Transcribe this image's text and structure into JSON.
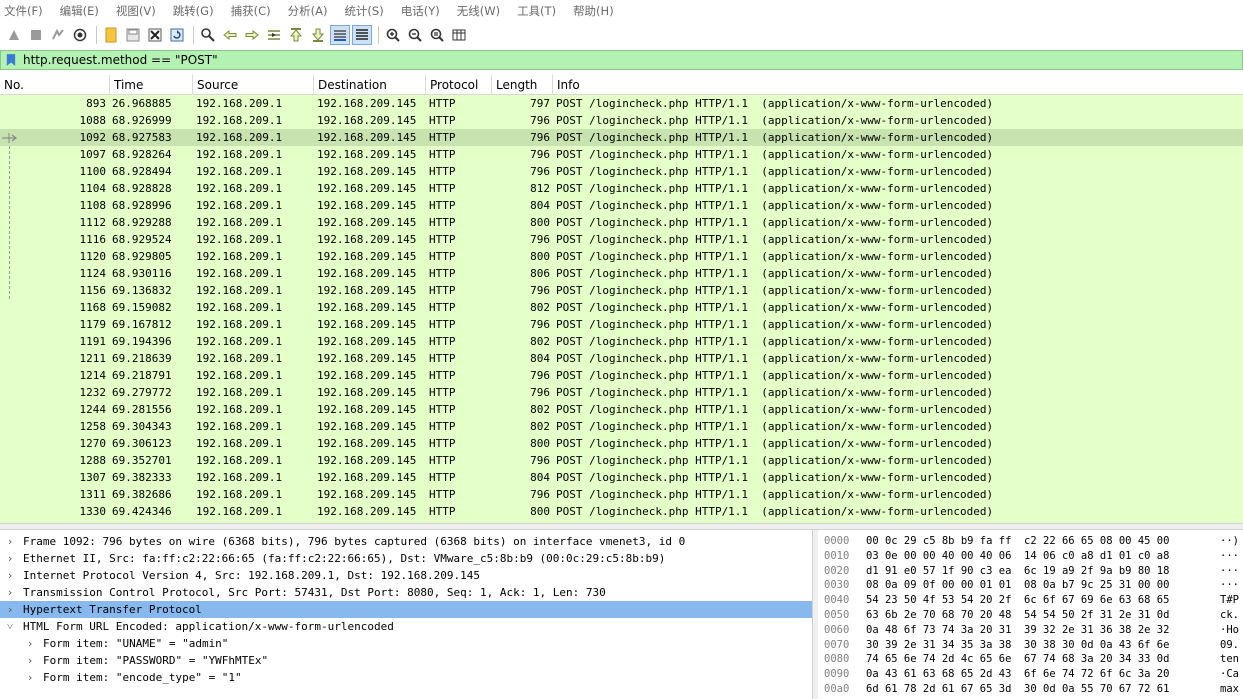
{
  "menubar": {
    "items": [
      "文件(F)",
      "编辑(E)",
      "视图(V)",
      "跳转(G)",
      "捕获(C)",
      "分析(A)",
      "统计(S)",
      "电话(Y)",
      "无线(W)",
      "工具(T)",
      "帮助(H)"
    ]
  },
  "toolbar": {
    "icons": [
      "start-capture-icon",
      "stop-capture-icon",
      "restart-capture-icon",
      "capture-options-icon",
      "open-file-icon",
      "save-file-icon",
      "close-file-icon",
      "reload-file-icon",
      "find-packet-icon",
      "go-back-icon",
      "go-forward-icon",
      "go-to-packet-icon",
      "go-first-icon",
      "go-last-icon",
      "auto-scroll-icon",
      "colorize-icon",
      "zoom-in-icon",
      "zoom-out-icon",
      "zoom-normal-icon",
      "resize-columns-icon"
    ]
  },
  "filter": {
    "value": "http.request.method == \"POST\""
  },
  "columns": {
    "no": "No.",
    "time": "Time",
    "source": "Source",
    "destination": "Destination",
    "protocol": "Protocol",
    "length": "Length",
    "info": "Info"
  },
  "packets": [
    {
      "no": "893",
      "time": "26.968885",
      "src": "192.168.209.1",
      "dst": "192.168.209.145",
      "proto": "HTTP",
      "len": "797",
      "info": "POST /logincheck.php HTTP/1.1  (application/x-www-form-urlencoded)"
    },
    {
      "no": "1088",
      "time": "68.926999",
      "src": "192.168.209.1",
      "dst": "192.168.209.145",
      "proto": "HTTP",
      "len": "796",
      "info": "POST /logincheck.php HTTP/1.1  (application/x-www-form-urlencoded)"
    },
    {
      "no": "1092",
      "time": "68.927583",
      "src": "192.168.209.1",
      "dst": "192.168.209.145",
      "proto": "HTTP",
      "len": "796",
      "info": "POST /logincheck.php HTTP/1.1  (application/x-www-form-urlencoded)"
    },
    {
      "no": "1097",
      "time": "68.928264",
      "src": "192.168.209.1",
      "dst": "192.168.209.145",
      "proto": "HTTP",
      "len": "796",
      "info": "POST /logincheck.php HTTP/1.1  (application/x-www-form-urlencoded)"
    },
    {
      "no": "1100",
      "time": "68.928494",
      "src": "192.168.209.1",
      "dst": "192.168.209.145",
      "proto": "HTTP",
      "len": "796",
      "info": "POST /logincheck.php HTTP/1.1  (application/x-www-form-urlencoded)"
    },
    {
      "no": "1104",
      "time": "68.928828",
      "src": "192.168.209.1",
      "dst": "192.168.209.145",
      "proto": "HTTP",
      "len": "812",
      "info": "POST /logincheck.php HTTP/1.1  (application/x-www-form-urlencoded)"
    },
    {
      "no": "1108",
      "time": "68.928996",
      "src": "192.168.209.1",
      "dst": "192.168.209.145",
      "proto": "HTTP",
      "len": "804",
      "info": "POST /logincheck.php HTTP/1.1  (application/x-www-form-urlencoded)"
    },
    {
      "no": "1112",
      "time": "68.929288",
      "src": "192.168.209.1",
      "dst": "192.168.209.145",
      "proto": "HTTP",
      "len": "800",
      "info": "POST /logincheck.php HTTP/1.1  (application/x-www-form-urlencoded)"
    },
    {
      "no": "1116",
      "time": "68.929524",
      "src": "192.168.209.1",
      "dst": "192.168.209.145",
      "proto": "HTTP",
      "len": "796",
      "info": "POST /logincheck.php HTTP/1.1  (application/x-www-form-urlencoded)"
    },
    {
      "no": "1120",
      "time": "68.929805",
      "src": "192.168.209.1",
      "dst": "192.168.209.145",
      "proto": "HTTP",
      "len": "800",
      "info": "POST /logincheck.php HTTP/1.1  (application/x-www-form-urlencoded)"
    },
    {
      "no": "1124",
      "time": "68.930116",
      "src": "192.168.209.1",
      "dst": "192.168.209.145",
      "proto": "HTTP",
      "len": "806",
      "info": "POST /logincheck.php HTTP/1.1  (application/x-www-form-urlencoded)"
    },
    {
      "no": "1156",
      "time": "69.136832",
      "src": "192.168.209.1",
      "dst": "192.168.209.145",
      "proto": "HTTP",
      "len": "796",
      "info": "POST /logincheck.php HTTP/1.1  (application/x-www-form-urlencoded)"
    },
    {
      "no": "1168",
      "time": "69.159082",
      "src": "192.168.209.1",
      "dst": "192.168.209.145",
      "proto": "HTTP",
      "len": "802",
      "info": "POST /logincheck.php HTTP/1.1  (application/x-www-form-urlencoded)"
    },
    {
      "no": "1179",
      "time": "69.167812",
      "src": "192.168.209.1",
      "dst": "192.168.209.145",
      "proto": "HTTP",
      "len": "796",
      "info": "POST /logincheck.php HTTP/1.1  (application/x-www-form-urlencoded)"
    },
    {
      "no": "1191",
      "time": "69.194396",
      "src": "192.168.209.1",
      "dst": "192.168.209.145",
      "proto": "HTTP",
      "len": "802",
      "info": "POST /logincheck.php HTTP/1.1  (application/x-www-form-urlencoded)"
    },
    {
      "no": "1211",
      "time": "69.218639",
      "src": "192.168.209.1",
      "dst": "192.168.209.145",
      "proto": "HTTP",
      "len": "804",
      "info": "POST /logincheck.php HTTP/1.1  (application/x-www-form-urlencoded)"
    },
    {
      "no": "1214",
      "time": "69.218791",
      "src": "192.168.209.1",
      "dst": "192.168.209.145",
      "proto": "HTTP",
      "len": "796",
      "info": "POST /logincheck.php HTTP/1.1  (application/x-www-form-urlencoded)"
    },
    {
      "no": "1232",
      "time": "69.279772",
      "src": "192.168.209.1",
      "dst": "192.168.209.145",
      "proto": "HTTP",
      "len": "796",
      "info": "POST /logincheck.php HTTP/1.1  (application/x-www-form-urlencoded)"
    },
    {
      "no": "1244",
      "time": "69.281556",
      "src": "192.168.209.1",
      "dst": "192.168.209.145",
      "proto": "HTTP",
      "len": "802",
      "info": "POST /logincheck.php HTTP/1.1  (application/x-www-form-urlencoded)"
    },
    {
      "no": "1258",
      "time": "69.304343",
      "src": "192.168.209.1",
      "dst": "192.168.209.145",
      "proto": "HTTP",
      "len": "802",
      "info": "POST /logincheck.php HTTP/1.1  (application/x-www-form-urlencoded)"
    },
    {
      "no": "1270",
      "time": "69.306123",
      "src": "192.168.209.1",
      "dst": "192.168.209.145",
      "proto": "HTTP",
      "len": "800",
      "info": "POST /logincheck.php HTTP/1.1  (application/x-www-form-urlencoded)"
    },
    {
      "no": "1288",
      "time": "69.352701",
      "src": "192.168.209.1",
      "dst": "192.168.209.145",
      "proto": "HTTP",
      "len": "796",
      "info": "POST /logincheck.php HTTP/1.1  (application/x-www-form-urlencoded)"
    },
    {
      "no": "1307",
      "time": "69.382333",
      "src": "192.168.209.1",
      "dst": "192.168.209.145",
      "proto": "HTTP",
      "len": "804",
      "info": "POST /logincheck.php HTTP/1.1  (application/x-www-form-urlencoded)"
    },
    {
      "no": "1311",
      "time": "69.382686",
      "src": "192.168.209.1",
      "dst": "192.168.209.145",
      "proto": "HTTP",
      "len": "796",
      "info": "POST /logincheck.php HTTP/1.1  (application/x-www-form-urlencoded)"
    },
    {
      "no": "1330",
      "time": "69.424346",
      "src": "192.168.209.1",
      "dst": "192.168.209.145",
      "proto": "HTTP",
      "len": "800",
      "info": "POST /logincheck.php HTTP/1.1  (application/x-www-form-urlencoded)"
    }
  ],
  "selected_packet_no": "1092",
  "details": [
    {
      "text": "Frame 1092: 796 bytes on wire (6368 bits), 796 bytes captured (6368 bits) on interface vmenet3, id 0",
      "expander": "collapsed",
      "indent": 0
    },
    {
      "text": "Ethernet II, Src: fa:ff:c2:22:66:65 (fa:ff:c2:22:66:65), Dst: VMware_c5:8b:b9 (00:0c:29:c5:8b:b9)",
      "expander": "collapsed",
      "indent": 0
    },
    {
      "text": "Internet Protocol Version 4, Src: 192.168.209.1, Dst: 192.168.209.145",
      "expander": "collapsed",
      "indent": 0
    },
    {
      "text": "Transmission Control Protocol, Src Port: 57431, Dst Port: 8080, Seq: 1, Ack: 1, Len: 730",
      "expander": "collapsed",
      "indent": 0
    },
    {
      "text": "Hypertext Transfer Protocol",
      "expander": "collapsed",
      "indent": 0,
      "selected": true
    },
    {
      "text": "HTML Form URL Encoded: application/x-www-form-urlencoded",
      "expander": "expanded",
      "indent": 0
    },
    {
      "text": "Form item: \"UNAME\" = \"admin\"",
      "expander": "collapsed",
      "indent": 1
    },
    {
      "text": "Form item: \"PASSWORD\" = \"YWFhMTEx\"",
      "expander": "collapsed",
      "indent": 1
    },
    {
      "text": "Form item: \"encode_type\" = \"1\"",
      "expander": "collapsed",
      "indent": 1
    }
  ],
  "bytes": [
    {
      "offset": "0000",
      "hex": "00 0c 29 c5 8b b9 fa ff  c2 22 66 65 08 00 45 00",
      "ascii": "··)"
    },
    {
      "offset": "0010",
      "hex": "03 0e 00 00 40 00 40 06  14 06 c0 a8 d1 01 c0 a8",
      "ascii": "···"
    },
    {
      "offset": "0020",
      "hex": "d1 91 e0 57 1f 90 c3 ea  6c 19 a9 2f 9a b9 80 18",
      "ascii": "···"
    },
    {
      "offset": "0030",
      "hex": "08 0a 09 0f 00 00 01 01  08 0a b7 9c 25 31 00 00",
      "ascii": "···"
    },
    {
      "offset": "0040",
      "hex": "54 23 50 4f 53 54 20 2f  6c 6f 67 69 6e 63 68 65",
      "ascii": "T#P"
    },
    {
      "offset": "0050",
      "hex": "63 6b 2e 70 68 70 20 48  54 54 50 2f 31 2e 31 0d",
      "ascii": "ck."
    },
    {
      "offset": "0060",
      "hex": "0a 48 6f 73 74 3a 20 31  39 32 2e 31 36 38 2e 32",
      "ascii": "·Ho"
    },
    {
      "offset": "0070",
      "hex": "30 39 2e 31 34 35 3a 38  30 38 30 0d 0a 43 6f 6e",
      "ascii": "09."
    },
    {
      "offset": "0080",
      "hex": "74 65 6e 74 2d 4c 65 6e  67 74 68 3a 20 34 33 0d",
      "ascii": "ten"
    },
    {
      "offset": "0090",
      "hex": "0a 43 61 63 68 65 2d 43  6f 6e 74 72 6f 6c 3a 20",
      "ascii": "·Ca"
    },
    {
      "offset": "00a0",
      "hex": "6d 61 78 2d 61 67 65 3d  30 0d 0a 55 70 67 72 61",
      "ascii": "max"
    }
  ],
  "colors": {
    "row_bg": "#e4ffc7",
    "row_selected_bg": "#c8e3b0",
    "filter_bg": "#b4f2b4",
    "detail_selected_bg": "#88b9ee"
  }
}
